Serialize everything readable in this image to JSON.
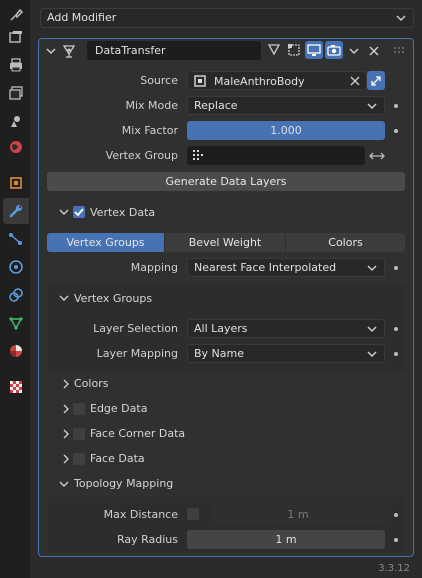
{
  "top": {
    "add_modifier": "Add Modifier"
  },
  "modifier": {
    "name": "DataTransfer",
    "source_label": "Source",
    "source_value": "MaleAnthroBody",
    "mix_mode_label": "Mix Mode",
    "mix_mode_value": "Replace",
    "mix_factor_label": "Mix Factor",
    "mix_factor_value": "1.000",
    "vertex_group_label": "Vertex Group",
    "vertex_group_value": "",
    "generate_button": "Generate Data Layers"
  },
  "vertex_data": {
    "title": "Vertex Data",
    "enabled": true,
    "tabs": [
      "Vertex Groups",
      "Bevel Weight",
      "Colors"
    ],
    "active_tab": "Vertex Groups",
    "mapping_label": "Mapping",
    "mapping_value": "Nearest Face Interpolated"
  },
  "vertex_groups": {
    "title": "Vertex Groups",
    "layer_selection_label": "Layer Selection",
    "layer_selection_value": "All Layers",
    "layer_mapping_label": "Layer Mapping",
    "layer_mapping_value": "By Name"
  },
  "sections": {
    "colors": "Colors",
    "edge_data": "Edge Data",
    "face_corner_data": "Face Corner Data",
    "face_data": "Face Data"
  },
  "topology": {
    "title": "Topology Mapping",
    "max_distance_label": "Max Distance",
    "max_distance_value": "1 m",
    "ray_radius_label": "Ray Radius",
    "ray_radius_value": "1 m"
  },
  "footer": {
    "version": "3.3.12"
  },
  "colors": {
    "accent": "#4772b3",
    "panel_border": "#4572b0"
  }
}
